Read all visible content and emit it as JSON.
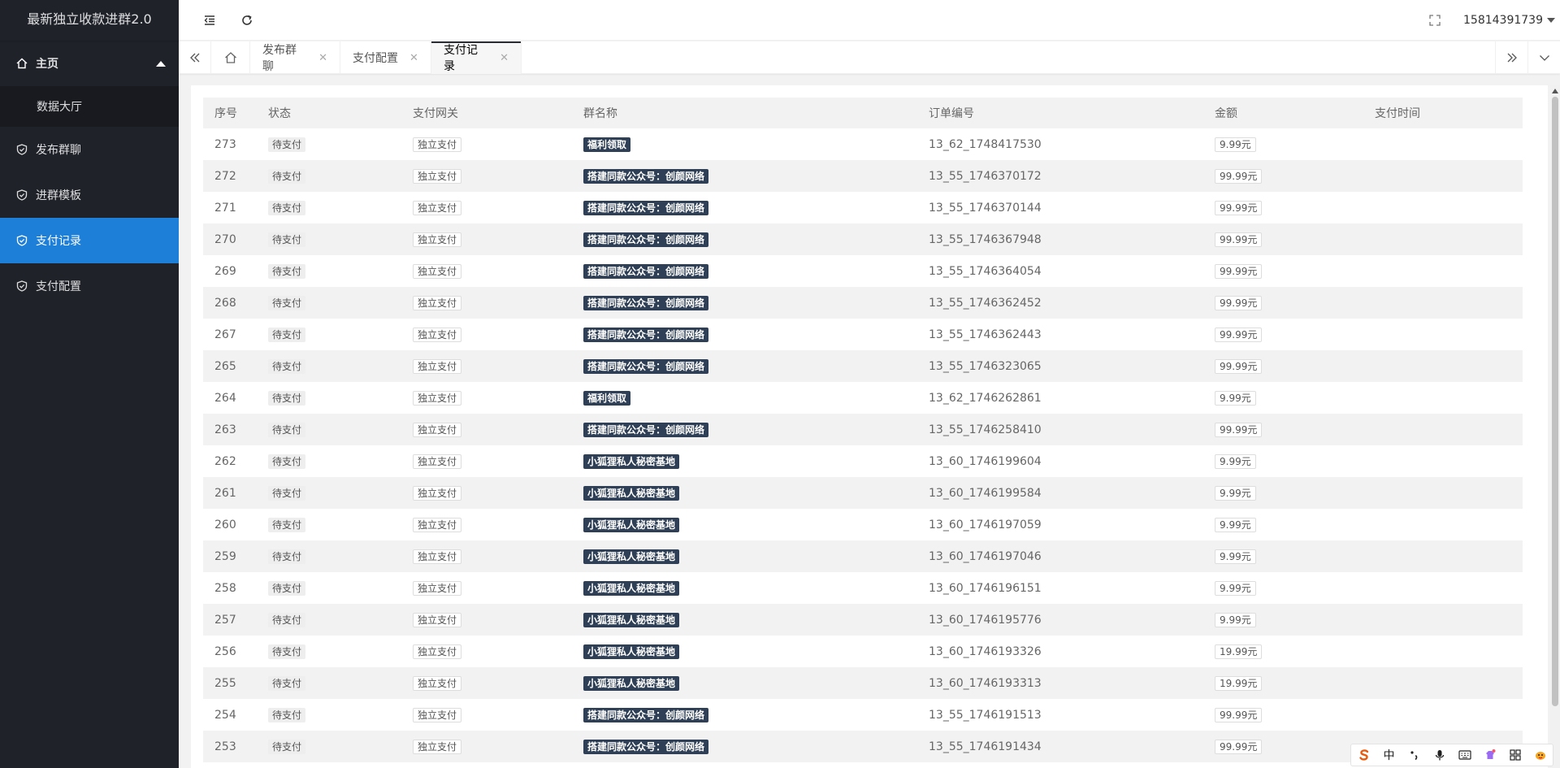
{
  "app": {
    "title": "最新独立收款进群2.0"
  },
  "sidebar": {
    "group": {
      "label": "主页"
    },
    "sub_items": [
      {
        "label": "数据大厅"
      }
    ],
    "items": [
      {
        "label": "发布群聊"
      },
      {
        "label": "进群模板"
      },
      {
        "label": "支付记录",
        "active": true
      },
      {
        "label": "支付配置"
      }
    ]
  },
  "header": {
    "user": "15814391739"
  },
  "tabs": [
    {
      "label": "发布群聊"
    },
    {
      "label": "支付配置"
    },
    {
      "label": "支付记录",
      "active": true
    }
  ],
  "table": {
    "columns": [
      "序号",
      "状态",
      "支付网关",
      "群名称",
      "订单编号",
      "金额",
      "支付时间"
    ],
    "rows": [
      {
        "id": "273",
        "status": "待支付",
        "gateway": "独立支付",
        "group": "福利领取",
        "order": "13_62_1748417530",
        "amount": "9.99元",
        "time": ""
      },
      {
        "id": "272",
        "status": "待支付",
        "gateway": "独立支付",
        "group": "搭建同款公众号：创颜网络",
        "order": "13_55_1746370172",
        "amount": "99.99元",
        "time": ""
      },
      {
        "id": "271",
        "status": "待支付",
        "gateway": "独立支付",
        "group": "搭建同款公众号：创颜网络",
        "order": "13_55_1746370144",
        "amount": "99.99元",
        "time": ""
      },
      {
        "id": "270",
        "status": "待支付",
        "gateway": "独立支付",
        "group": "搭建同款公众号：创颜网络",
        "order": "13_55_1746367948",
        "amount": "99.99元",
        "time": ""
      },
      {
        "id": "269",
        "status": "待支付",
        "gateway": "独立支付",
        "group": "搭建同款公众号：创颜网络",
        "order": "13_55_1746364054",
        "amount": "99.99元",
        "time": ""
      },
      {
        "id": "268",
        "status": "待支付",
        "gateway": "独立支付",
        "group": "搭建同款公众号：创颜网络",
        "order": "13_55_1746362452",
        "amount": "99.99元",
        "time": ""
      },
      {
        "id": "267",
        "status": "待支付",
        "gateway": "独立支付",
        "group": "搭建同款公众号：创颜网络",
        "order": "13_55_1746362443",
        "amount": "99.99元",
        "time": ""
      },
      {
        "id": "265",
        "status": "待支付",
        "gateway": "独立支付",
        "group": "搭建同款公众号：创颜网络",
        "order": "13_55_1746323065",
        "amount": "99.99元",
        "time": ""
      },
      {
        "id": "264",
        "status": "待支付",
        "gateway": "独立支付",
        "group": "福利领取",
        "order": "13_62_1746262861",
        "amount": "9.99元",
        "time": ""
      },
      {
        "id": "263",
        "status": "待支付",
        "gateway": "独立支付",
        "group": "搭建同款公众号：创颜网络",
        "order": "13_55_1746258410",
        "amount": "99.99元",
        "time": ""
      },
      {
        "id": "262",
        "status": "待支付",
        "gateway": "独立支付",
        "group": "小狐狸私人秘密基地",
        "order": "13_60_1746199604",
        "amount": "9.99元",
        "time": ""
      },
      {
        "id": "261",
        "status": "待支付",
        "gateway": "独立支付",
        "group": "小狐狸私人秘密基地",
        "order": "13_60_1746199584",
        "amount": "9.99元",
        "time": ""
      },
      {
        "id": "260",
        "status": "待支付",
        "gateway": "独立支付",
        "group": "小狐狸私人秘密基地",
        "order": "13_60_1746197059",
        "amount": "9.99元",
        "time": ""
      },
      {
        "id": "259",
        "status": "待支付",
        "gateway": "独立支付",
        "group": "小狐狸私人秘密基地",
        "order": "13_60_1746197046",
        "amount": "9.99元",
        "time": ""
      },
      {
        "id": "258",
        "status": "待支付",
        "gateway": "独立支付",
        "group": "小狐狸私人秘密基地",
        "order": "13_60_1746196151",
        "amount": "9.99元",
        "time": ""
      },
      {
        "id": "257",
        "status": "待支付",
        "gateway": "独立支付",
        "group": "小狐狸私人秘密基地",
        "order": "13_60_1746195776",
        "amount": "9.99元",
        "time": ""
      },
      {
        "id": "256",
        "status": "待支付",
        "gateway": "独立支付",
        "group": "小狐狸私人秘密基地",
        "order": "13_60_1746193326",
        "amount": "19.99元",
        "time": ""
      },
      {
        "id": "255",
        "status": "待支付",
        "gateway": "独立支付",
        "group": "小狐狸私人秘密基地",
        "order": "13_60_1746193313",
        "amount": "19.99元",
        "time": ""
      },
      {
        "id": "254",
        "status": "待支付",
        "gateway": "独立支付",
        "group": "搭建同款公众号：创颜网络",
        "order": "13_55_1746191513",
        "amount": "99.99元",
        "time": ""
      },
      {
        "id": "253",
        "status": "待支付",
        "gateway": "独立支付",
        "group": "搭建同款公众号：创颜网络",
        "order": "13_55_1746191434",
        "amount": "99.99元",
        "time": ""
      }
    ]
  },
  "ime": {
    "lang": "中"
  },
  "colors": {
    "sidebar_bg": "#20222a",
    "active_blue": "#1e7fd8",
    "group_tag": "#2f4056"
  }
}
